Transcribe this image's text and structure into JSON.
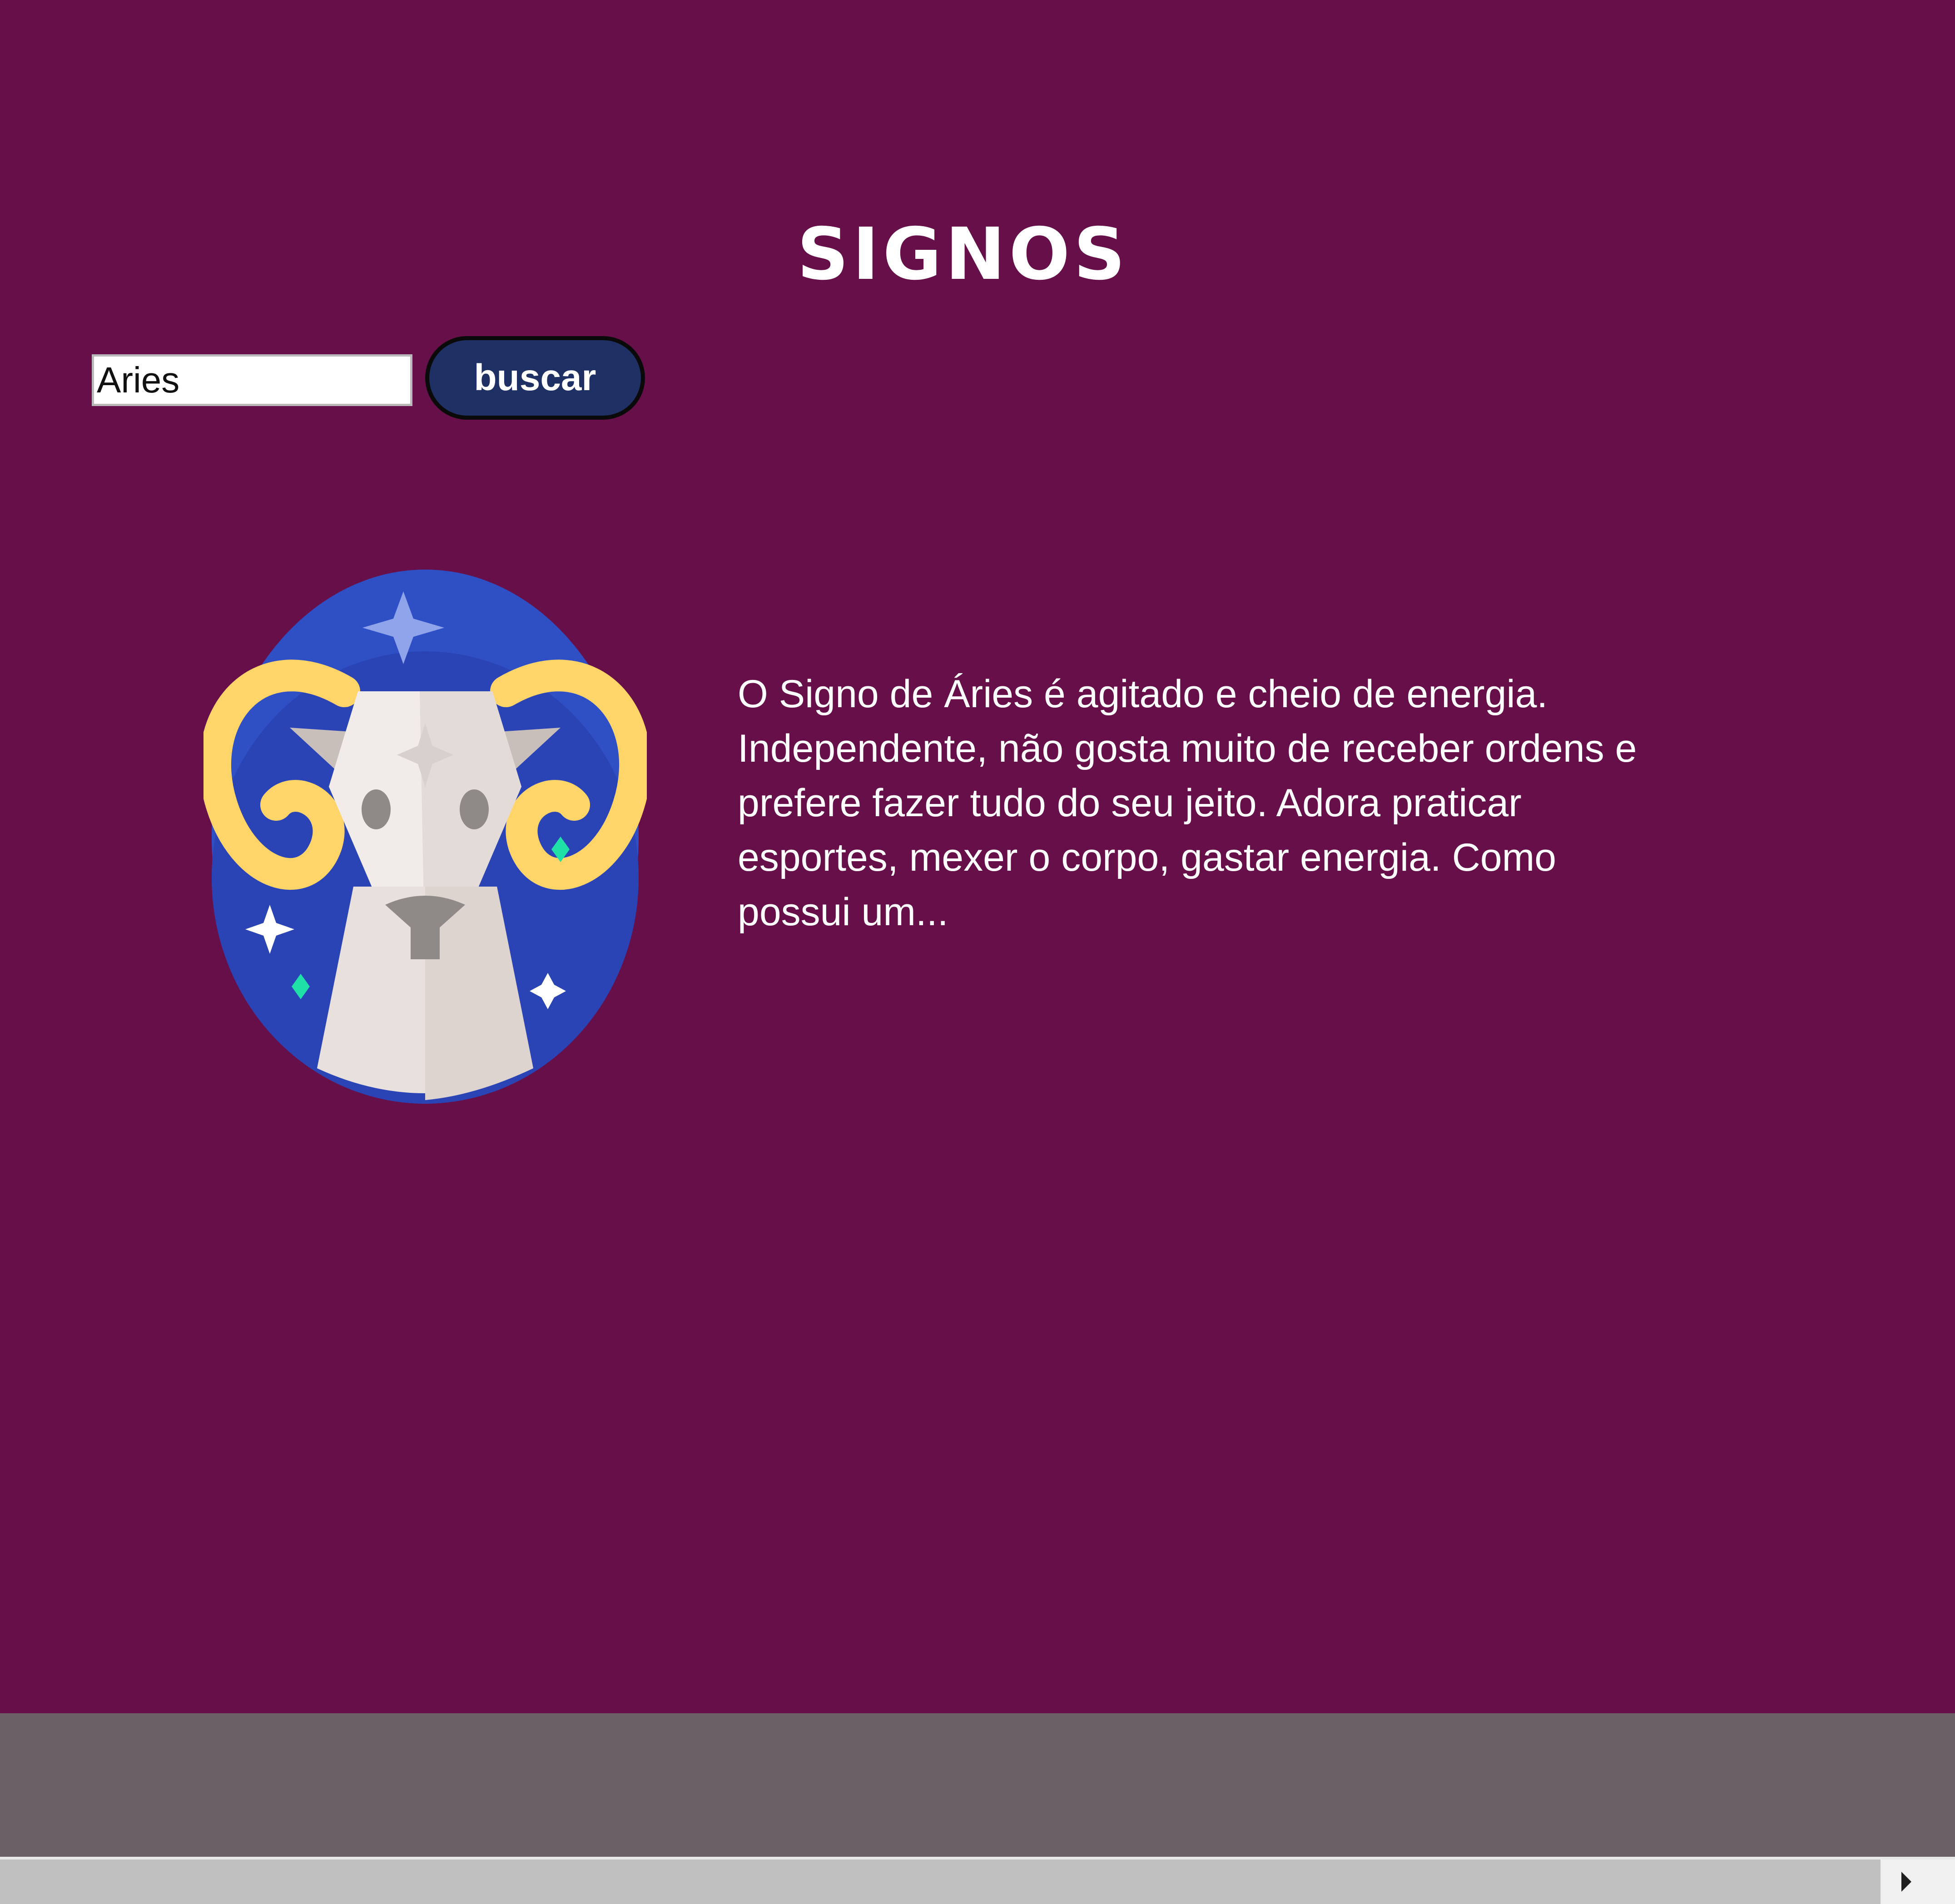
{
  "header": {
    "title": "SIGNOS"
  },
  "search": {
    "value": "Aries",
    "button_label": "buscar"
  },
  "sign": {
    "image_icon": "aries-ram-icon",
    "description": "O Signo de Áries é agitado e cheio de energia. Independente, não gosta muito de receber ordens e prefere fazer tudo do seu jeito. Adora praticar esportes, mexer o corpo, gastar energia. Como possui um..."
  },
  "colors": {
    "background": "#670f48",
    "footer": "#6a6065",
    "button": "#1e3064",
    "text": "#ffffff"
  }
}
